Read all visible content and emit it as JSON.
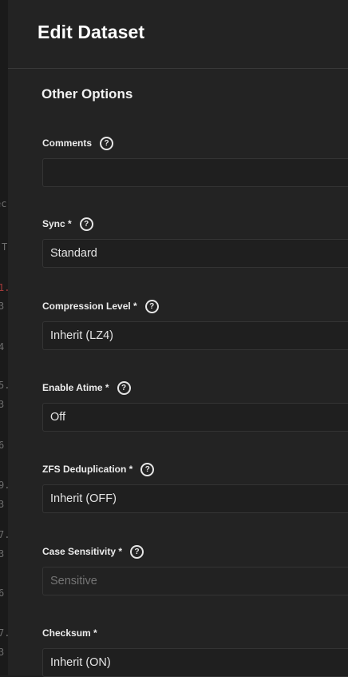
{
  "dialog": {
    "title": "Edit Dataset",
    "section_title": "Other Options"
  },
  "background_fragments": [
    "ec",
    "T",
    "1.",
    "3",
    "4",
    "5.",
    "3",
    "6",
    "9.",
    "3",
    "7.",
    "3",
    "6",
    "7.",
    "3"
  ],
  "fields": [
    {
      "label": "Comments",
      "value": "",
      "help": "?",
      "disabled": false
    },
    {
      "label": "Sync *",
      "value": "Standard",
      "help": "?",
      "disabled": false
    },
    {
      "label": "Compression Level *",
      "value": "Inherit (LZ4)",
      "help": "?",
      "disabled": false
    },
    {
      "label": "Enable Atime *",
      "value": "Off",
      "help": "?",
      "disabled": false
    },
    {
      "label": "ZFS Deduplication *",
      "value": "Inherit (OFF)",
      "help": "?",
      "disabled": false
    },
    {
      "label": "Case Sensitivity *",
      "value": "Sensitive",
      "help": "?",
      "disabled": true
    },
    {
      "label": "Checksum *",
      "value": "Inherit (ON)",
      "help": null,
      "disabled": false
    }
  ]
}
